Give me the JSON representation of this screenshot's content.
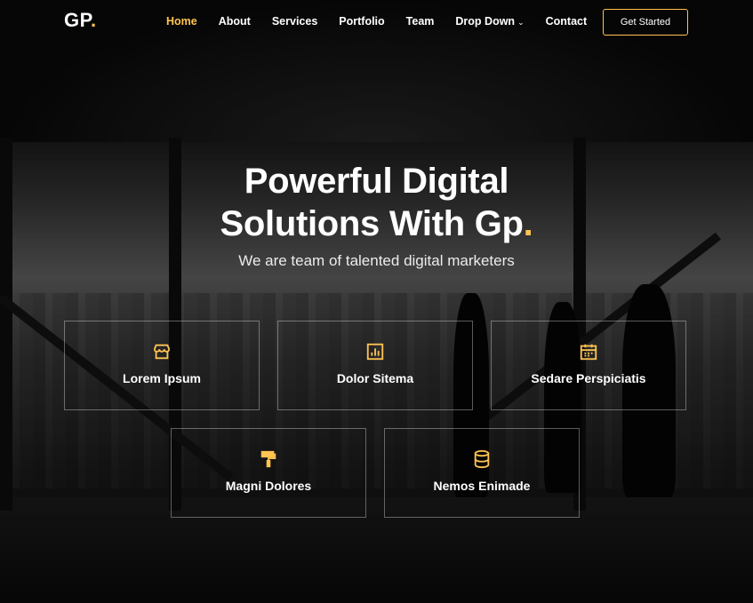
{
  "brand": {
    "logo_text": "GP",
    "logo_dot": "."
  },
  "nav": {
    "items": [
      {
        "label": "Home",
        "active": true
      },
      {
        "label": "About"
      },
      {
        "label": "Services"
      },
      {
        "label": "Portfolio"
      },
      {
        "label": "Team"
      },
      {
        "label": "Drop Down",
        "dropdown": true
      },
      {
        "label": "Contact"
      }
    ],
    "cta_label": "Get Started"
  },
  "hero": {
    "title_line1": "Powerful Digital",
    "title_line2": "Solutions With Gp",
    "title_dot": ".",
    "subtitle": "We are team of talented digital marketers"
  },
  "features": [
    {
      "label": "Lorem Ipsum",
      "icon": "store-icon"
    },
    {
      "label": "Dolor Sitema",
      "icon": "bar-chart-icon"
    },
    {
      "label": "Sedare Perspiciatis",
      "icon": "calendar-icon"
    },
    {
      "label": "Magni Dolores",
      "icon": "paint-roller-icon"
    },
    {
      "label": "Nemos Enimade",
      "icon": "database-icon"
    }
  ],
  "colors": {
    "accent": "#ffc451",
    "text": "#ffffff"
  }
}
